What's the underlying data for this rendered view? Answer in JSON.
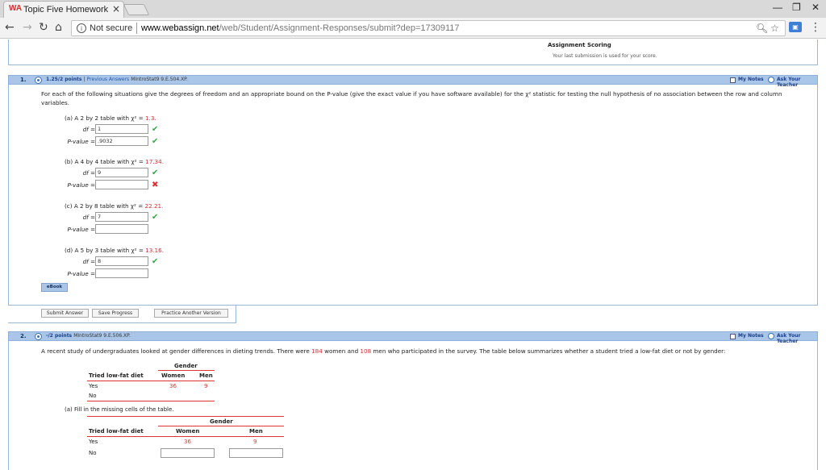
{
  "browser": {
    "tab_title": "Topic Five Homework",
    "tab_logo": "WA",
    "tab_close": "×",
    "not_secure": "Not secure",
    "url_host": "www.webassign.net",
    "url_path": "/web/Student/Assignment-Responses/submit?dep=17309117"
  },
  "scoring": {
    "title": "Assignment Scoring",
    "subtitle": "Your last submission is used for your score."
  },
  "q1": {
    "num": "1.",
    "points": "1.25/2 points",
    "sep": "|",
    "prev": "Previous Answers",
    "code": "MIntroStat9 9.E.504.XP.",
    "my_notes": "My Notes",
    "ask": "Ask Your Teacher",
    "text": "For each of the following situations give the degrees of freedom and an appropriate bound on the P-value (give the exact value if you have software available) for the χ² statistic for testing the null hypothesis of no association between the row and column variables.",
    "parts": [
      {
        "prefix": "(a) A 2 by 2 table with χ² = ",
        "value": "1.3.",
        "df": "1",
        "p": ".9032",
        "df_mark": "✔",
        "p_mark": "✔"
      },
      {
        "prefix": "(b) A 4 by 4 table with χ² = ",
        "value": "17.34.",
        "df": "9",
        "p": "",
        "df_mark": "✔",
        "p_mark": "✖"
      },
      {
        "prefix": "(c) A 2 by 8 table with χ² = ",
        "value": "22.21.",
        "df": "7",
        "p": "",
        "df_mark": "✔",
        "p_mark": ""
      },
      {
        "prefix": "(d) A 5 by 3 table with χ² = ",
        "value": "13.16.",
        "df": "8",
        "p": "",
        "df_mark": "✔",
        "p_mark": ""
      }
    ],
    "df_label": "df",
    "p_label": "P-value",
    "eq": " =",
    "ebook": "eBook",
    "submit": "Submit Answer",
    "save": "Save Progress",
    "practice": "Practice Another Version"
  },
  "q2": {
    "num": "2.",
    "points": "-/2 points",
    "code": "MIntroStat9 9.E.506.XP.",
    "my_notes": "My Notes",
    "ask": "Ask Your Teacher",
    "text_a": "A recent study of undergraduates looked at gender differences in dieting trends. There were ",
    "women_n": "184",
    "text_b": " women and ",
    "men_n": "108",
    "text_c": " men who participated in the survey. The table below summarizes whether a student tried a low-fat diet or not by gender:",
    "table": {
      "gender": "Gender",
      "row_header": "Tried low-fat diet",
      "women": "Women",
      "men": "Men",
      "yes": "Yes",
      "no": "No",
      "yes_women": "36",
      "yes_men": "9"
    },
    "part_a": "(a) Fill in the missing cells of the table."
  }
}
